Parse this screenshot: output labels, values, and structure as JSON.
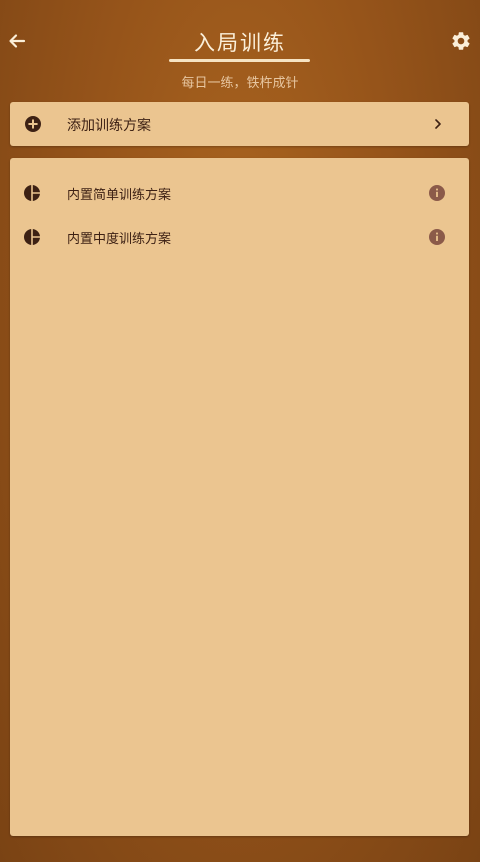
{
  "header": {
    "title": "入局训练",
    "subtitle": "每日一练，铁杵成针",
    "back_icon": "arrow-left-icon",
    "settings_icon": "gear-icon"
  },
  "add_plan": {
    "label": "添加训练方案",
    "icon": "plus-circle-icon",
    "chevron_icon": "chevron-right-icon"
  },
  "plans": [
    {
      "label": "内置简单训练方案",
      "icon": "pie-chart-icon",
      "info_icon": "info-icon"
    },
    {
      "label": "内置中度训练方案",
      "icon": "pie-chart-icon",
      "info_icon": "info-icon"
    }
  ],
  "colors": {
    "background": "#96541a",
    "card": "#ebc590",
    "text_dark": "#3d2114",
    "title_text": "#fbefd9",
    "info": "#8b5a49"
  }
}
